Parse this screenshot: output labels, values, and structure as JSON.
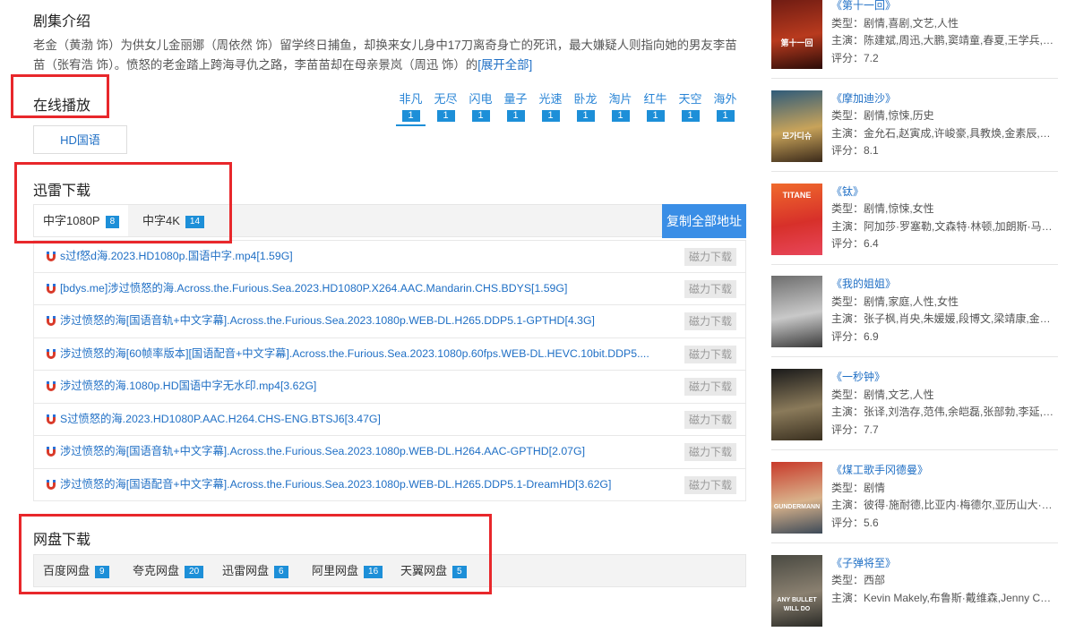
{
  "intro": {
    "title": "剧集介绍",
    "text": "老金（黄渤 饰）为供女儿金丽娜（周依然 饰）留学终日捕鱼，却换来女儿身中17刀离奇身亡的死讯，最大嫌疑人则指向她的男友李苗苗（张宥浩 饰）。愤怒的老金踏上跨海寻仇之路，李苗苗却在母亲景岚（周迅 饰）的",
    "more": "[展开全部]"
  },
  "online": {
    "title": "在线播放",
    "sources": [
      {
        "name": "非凡",
        "count": "1"
      },
      {
        "name": "无尽",
        "count": "1"
      },
      {
        "name": "闪电",
        "count": "1"
      },
      {
        "name": "量子",
        "count": "1"
      },
      {
        "name": "光速",
        "count": "1"
      },
      {
        "name": "卧龙",
        "count": "1"
      },
      {
        "name": "淘片",
        "count": "1"
      },
      {
        "name": "红牛",
        "count": "1"
      },
      {
        "name": "天空",
        "count": "1"
      },
      {
        "name": "海外",
        "count": "1"
      }
    ],
    "episode": "HD国语"
  },
  "xunlei": {
    "title": "迅雷下载",
    "tabs": [
      {
        "label": "中字1080P",
        "count": "8"
      },
      {
        "label": "中字4K",
        "count": "14"
      }
    ],
    "copy_all": "复制全部地址",
    "magnet_label": "磁力下载",
    "links": [
      "s过f怒d海.2023.HD1080p.国语中字.mp4[1.59G]",
      "[bdys.me]涉过愤怒的海.Across.the.Furious.Sea.2023.HD1080P.X264.AAC.Mandarin.CHS.BDYS[1.59G]",
      "涉过愤怒的海[国语音轨+中文字幕].Across.the.Furious.Sea.2023.1080p.WEB-DL.H265.DDP5.1-GPTHD[4.3G]",
      "涉过愤怒的海[60帧率版本][国语配音+中文字幕].Across.the.Furious.Sea.2023.1080p.60fps.WEB-DL.HEVC.10bit.DDP5....",
      "涉过愤怒的海.1080p.HD国语中字无水印.mp4[3.62G]",
      "S过愤怒的海.2023.HD1080P.AAC.H264.CHS-ENG.BTSJ6[3.47G]",
      "涉过愤怒的海[国语音轨+中文字幕].Across.the.Furious.Sea.2023.1080p.WEB-DL.H264.AAC-GPTHD[2.07G]",
      "涉过愤怒的海[国语配音+中文字幕].Across.the.Furious.Sea.2023.1080p.WEB-DL.H265.DDP5.1-DreamHD[3.62G]"
    ]
  },
  "pan": {
    "title": "网盘下载",
    "items": [
      {
        "label": "百度网盘",
        "count": "9"
      },
      {
        "label": "夸克网盘",
        "count": "20"
      },
      {
        "label": "迅雷网盘",
        "count": "6"
      },
      {
        "label": "阿里网盘",
        "count": "16"
      },
      {
        "label": "天翼网盘",
        "count": "5"
      }
    ]
  },
  "sidebar": {
    "items": [
      {
        "title": "《第十一回》",
        "type": "类型：剧情,喜剧,文艺,人性",
        "cast": "主演：陈建斌,周迅,大鹏,窦靖童,春夏,王学兵,宋...",
        "score": "评分：7.2",
        "poster_text": "第十一回",
        "colors": [
          "#6b1a12",
          "#b83a1e",
          "#2b0c08"
        ]
      },
      {
        "title": "《摩加迪沙》",
        "type": "类型：剧情,惊悚,历史",
        "cast": "主演：金允石,赵寅成,许峻豪,具教焕,金素辰,郑...",
        "score": "评分：8.1",
        "poster_text": "모가디슈",
        "colors": [
          "#2f5b7a",
          "#c8a35a",
          "#3b2a1a"
        ]
      },
      {
        "title": "《钛》",
        "type": "类型：剧情,惊悚,女性",
        "cast": "主演：阿加莎·罗塞勒,文森特·林顿,加朗斯·马里...",
        "score": "评分：6.4",
        "poster_text": "TITANE",
        "colors": [
          "#f06a2c",
          "#d7302a",
          "#e8465a"
        ]
      },
      {
        "title": "《我的姐姐》",
        "type": "类型：剧情,家庭,人性,女性",
        "cast": "主演：张子枫,肖央,朱媛媛,段博文,梁靖康,金遥...",
        "score": "评分：6.9",
        "poster_text": "",
        "colors": [
          "#6e6e6e",
          "#c9c9c9",
          "#3a3a3a"
        ]
      },
      {
        "title": "《一秒钟》",
        "type": "类型：剧情,文艺,人性",
        "cast": "主演：张译,刘浩存,范伟,余皑磊,张部勃,李延,于...",
        "score": "评分：7.7",
        "poster_text": "",
        "colors": [
          "#1a1a1a",
          "#8a7a5a",
          "#3a3020"
        ]
      },
      {
        "title": "《煤工歌手冈德曼》",
        "type": "类型：剧情",
        "cast": "主演：彼得·施耐德,比亚内·梅德尔,亚历山大·谢尔",
        "score": "评分：5.6",
        "poster_text": "GUNDERMANN",
        "colors": [
          "#c83a2a",
          "#d9b38c",
          "#3d4a58"
        ]
      },
      {
        "title": "《子弹将至》",
        "type": "类型：西部",
        "cast": "主演：Kevin Makely,布鲁斯·戴维森,Jenny Cur...",
        "score": "",
        "poster_text": "ANY BULLET WILL DO",
        "colors": [
          "#4a4a42",
          "#8a8070",
          "#2a2a26"
        ]
      }
    ]
  }
}
